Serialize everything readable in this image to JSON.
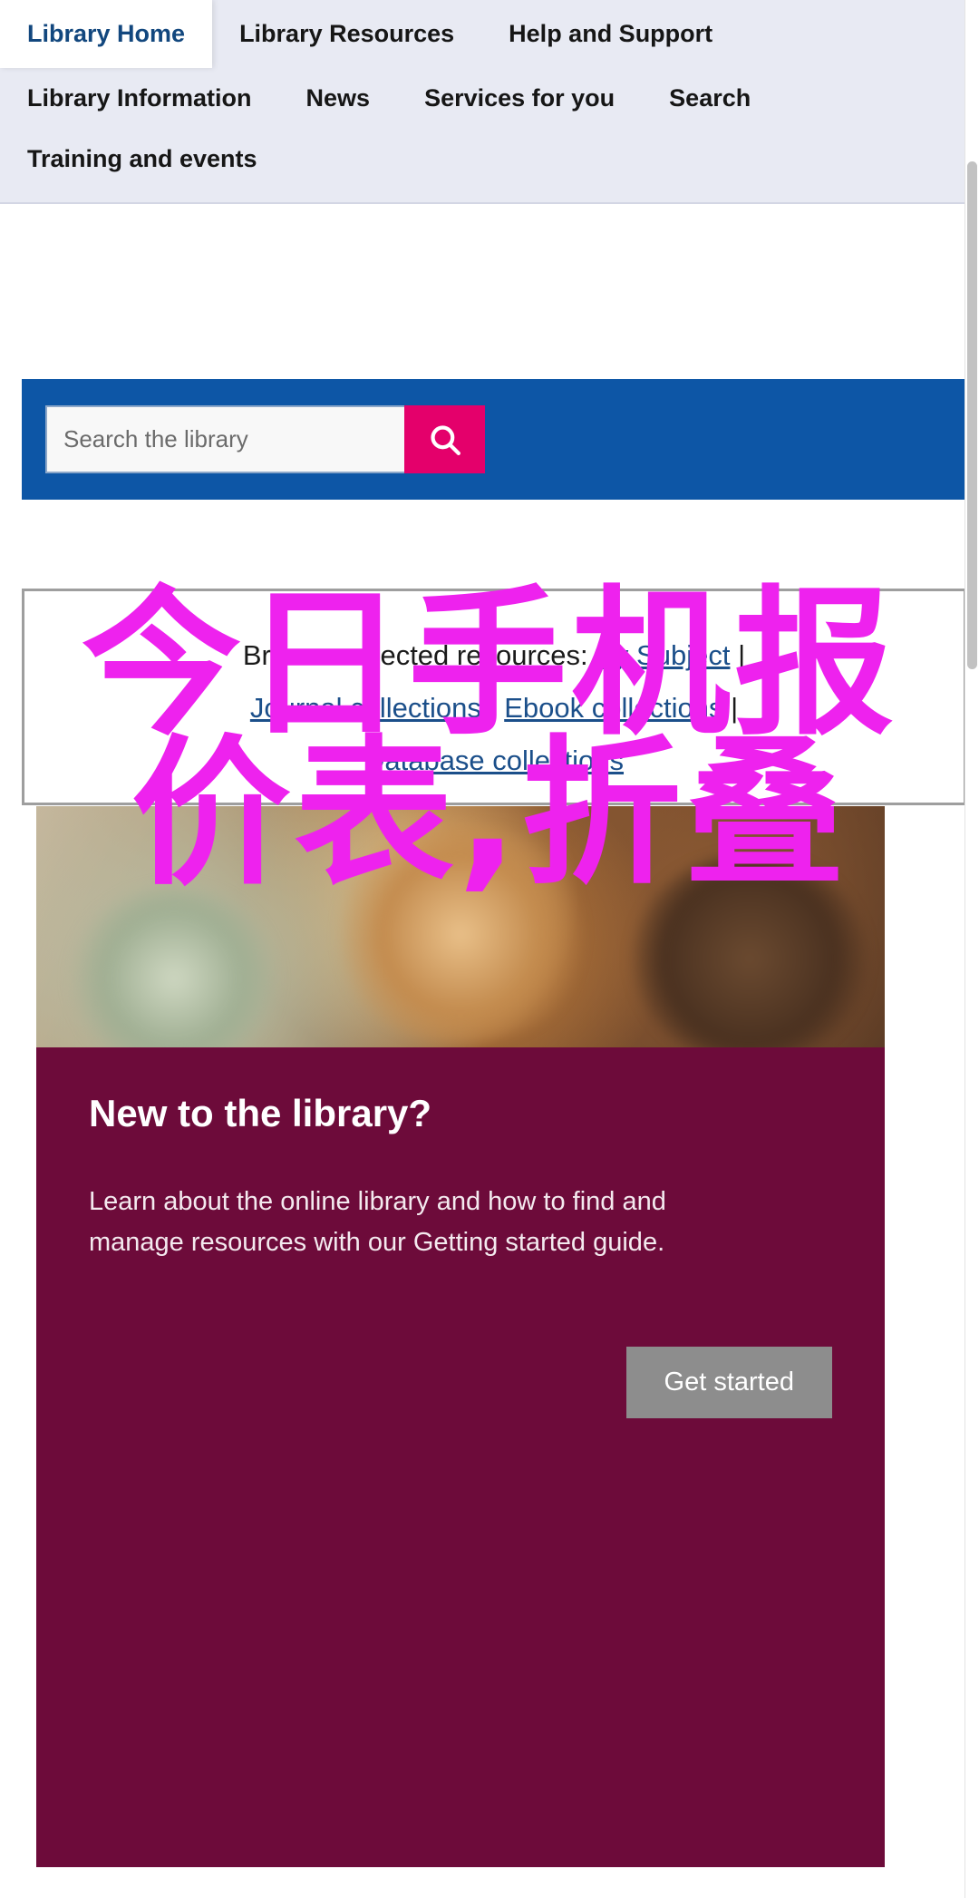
{
  "nav": {
    "rows": [
      [
        {
          "label": "Library Home",
          "active": true
        },
        {
          "label": "Library Resources",
          "active": false
        },
        {
          "label": "Help and Support",
          "active": false
        }
      ],
      [
        {
          "label": "Library Information",
          "active": false
        },
        {
          "label": "News",
          "active": false
        },
        {
          "label": "Services for you",
          "active": false
        },
        {
          "label": "Search",
          "active": false
        }
      ],
      [
        {
          "label": "Training and events",
          "active": false
        }
      ]
    ]
  },
  "search": {
    "placeholder": "Search the library",
    "value": "",
    "button_icon": "search-icon",
    "banner_color": "#0d56a6",
    "button_color": "#e4006b"
  },
  "browse": {
    "label": "Browse selected resources:",
    "links": [
      "By Subject",
      "Journal collections",
      "Ebook collections",
      "Database collections"
    ],
    "separator": "|"
  },
  "promo": {
    "title": "New to the library?",
    "text": "Learn about the online library and how to find and manage resources with our Getting started guide.",
    "button_label": "Get started",
    "background_color": "#6d0b3a",
    "button_color": "#8d8d8d"
  },
  "watermark": {
    "line1": "今日手机报",
    "line2": "价表,折叠",
    "color": "#ee22ee"
  }
}
